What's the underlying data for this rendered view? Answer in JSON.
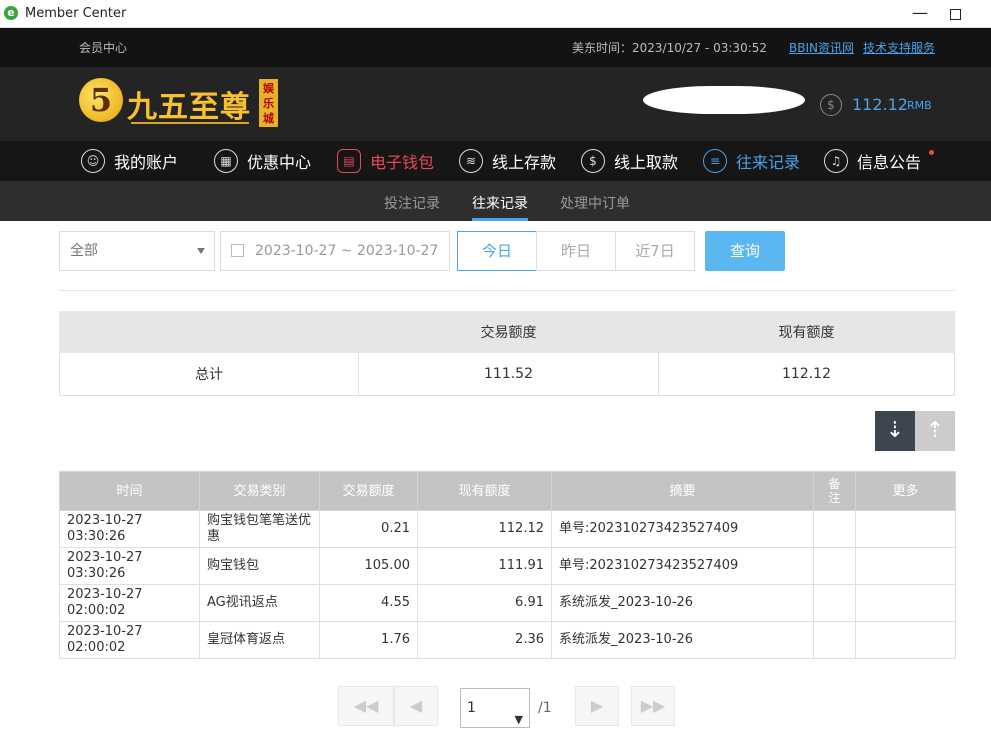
{
  "window": {
    "title": "Member Center"
  },
  "topbar": {
    "member_center": "会员中心",
    "time_label": "美东时间：2023/10/27 - 03:30:52",
    "links": [
      "BBIN资讯网",
      "技术支持服务"
    ]
  },
  "header": {
    "brand": "九五至尊",
    "badge": "娱乐城",
    "balance": "112.12",
    "currency": "RMB"
  },
  "nav": [
    {
      "label": "我的账户",
      "icon": "user-icon"
    },
    {
      "label": "优惠中心",
      "icon": "gift-icon"
    },
    {
      "label": "电子钱包",
      "icon": "wallet-icon"
    },
    {
      "label": "线上存款",
      "icon": "deposit-icon"
    },
    {
      "label": "线上取款",
      "icon": "withdraw-icon"
    },
    {
      "label": "往来记录",
      "icon": "records-icon"
    },
    {
      "label": "信息公告",
      "icon": "bell-icon"
    }
  ],
  "subnav": [
    "投注记录",
    "往来记录",
    "处理中订单"
  ],
  "filters": {
    "type_select": "全部",
    "date_range": "2023-10-27 ~ 2023-10-27",
    "quick": [
      "今日",
      "昨日",
      "近7日"
    ],
    "search": "查询"
  },
  "summary": {
    "headers": [
      "",
      "交易额度",
      "现有额度"
    ],
    "row": [
      "总计",
      "111.52",
      "112.12"
    ]
  },
  "table": {
    "headers": [
      "时间",
      "交易类别",
      "交易额度",
      "现有额度",
      "摘要",
      "备注",
      "更多"
    ],
    "rows": [
      [
        "2023-10-27 03:30:26",
        "购宝钱包笔笔送优惠",
        "0.21",
        "112.12",
        "单号:202310273423527409",
        "",
        ""
      ],
      [
        "2023-10-27 03:30:26",
        "购宝钱包",
        "105.00",
        "111.91",
        "单号:202310273423527409",
        "",
        ""
      ],
      [
        "2023-10-27 02:00:02",
        "AG视讯返点",
        "4.55",
        "6.91",
        "系统派发_2023-10-26",
        "",
        ""
      ],
      [
        "2023-10-27 02:00:02",
        "皇冠体育返点",
        "1.76",
        "2.36",
        "系统派发_2023-10-26",
        "",
        ""
      ]
    ]
  },
  "pagination": {
    "current": "1",
    "total": "/1"
  },
  "colors": {
    "accent": "#4aa3e8",
    "active_nav": "#e8465a",
    "gold": "#f6c030"
  }
}
